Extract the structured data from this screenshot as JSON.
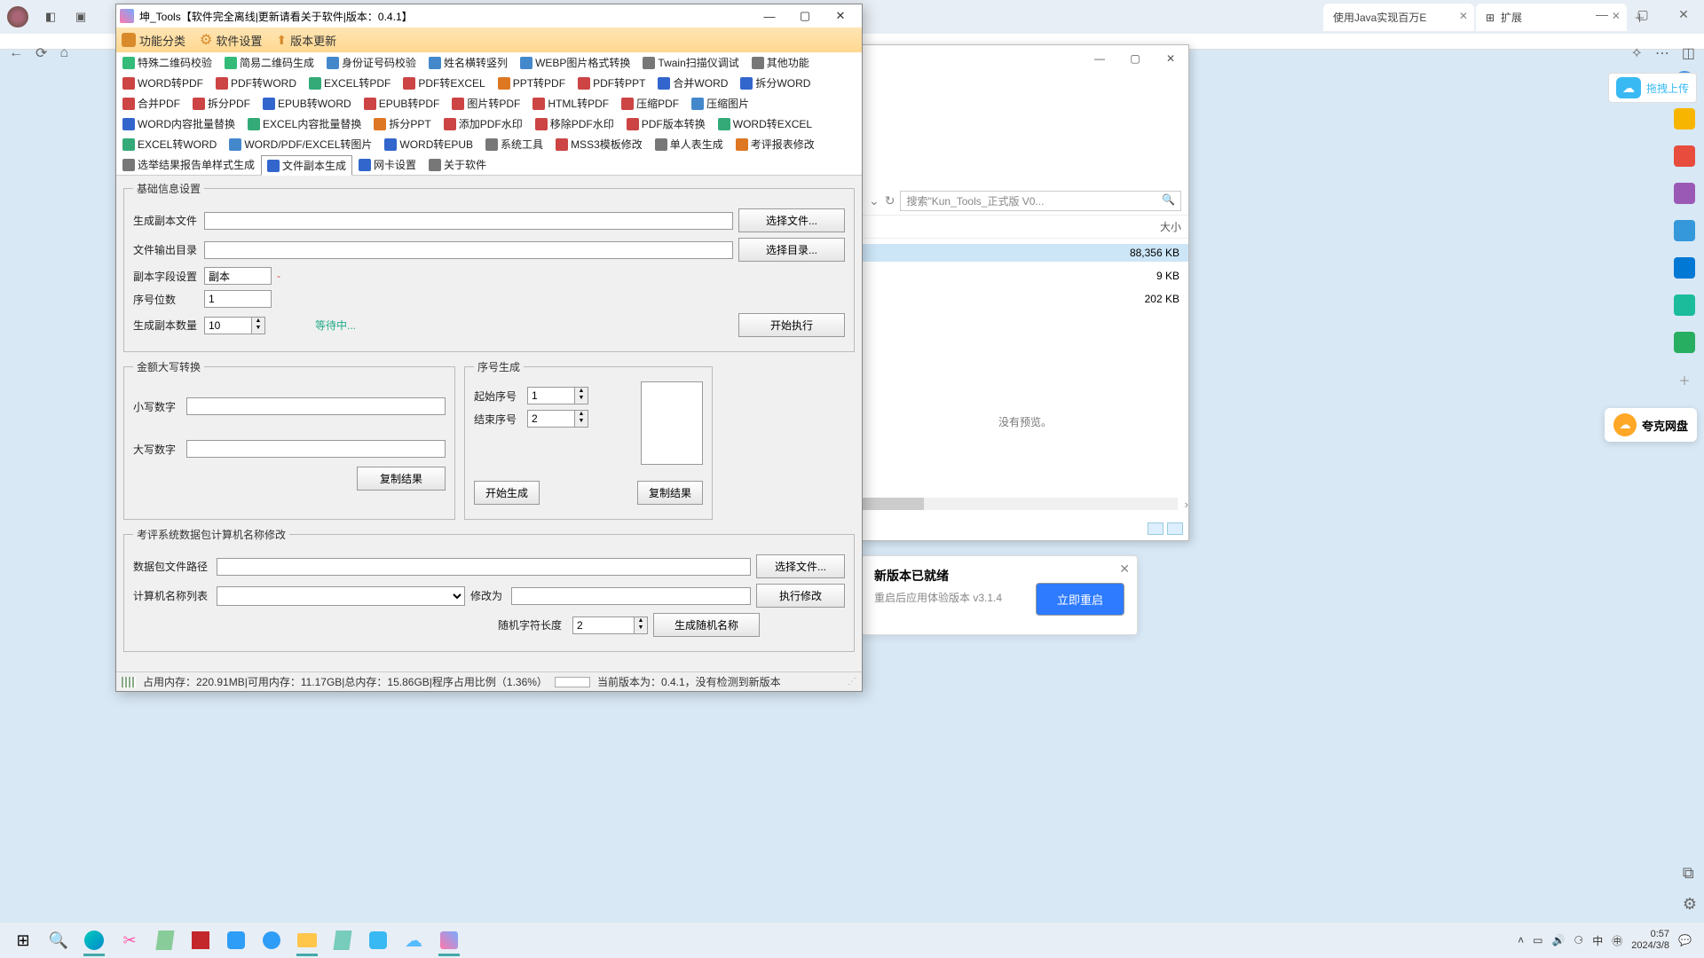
{
  "browser": {
    "tabs": [
      {
        "label": "使用Java实现百万E",
        "icon": "#4088d8"
      },
      {
        "label": "扩展",
        "icon": "#4088d8"
      }
    ],
    "win": [
      "—",
      "▢",
      "✕"
    ],
    "upload_label": "拖拽上传",
    "quark_label": "夸克网盘"
  },
  "explorer": {
    "win": [
      "—",
      "▢",
      "✕"
    ],
    "search_placeholder": "搜索\"Kun_Tools_正式版 V0...",
    "col_size": "大小",
    "rows": [
      {
        "size": "88,356 KB",
        "sel": true
      },
      {
        "size": "9 KB"
      },
      {
        "size": "202 KB"
      }
    ],
    "preview": "没有预览。"
  },
  "update": {
    "title": "新版本已就绪",
    "sub": "重启后应用体验版本 v3.1.4",
    "btn": "立即重启"
  },
  "app": {
    "title": "坤_Tools【软件完全离线|更新请看关于软件|版本：0.4.1】",
    "menu": [
      {
        "label": "功能分类",
        "color": "#d98b2b"
      },
      {
        "label": "软件设置",
        "color": "#d98b2b"
      },
      {
        "label": "版本更新",
        "color": "#d98b2b"
      }
    ],
    "tabs": [
      {
        "label": "特殊二维码校验",
        "c": "#3b7"
      },
      {
        "label": "简易二维码生成",
        "c": "#3b7"
      },
      {
        "label": "身份证号码校验",
        "c": "#48c"
      },
      {
        "label": "姓名横转竖列",
        "c": "#48c"
      },
      {
        "label": "WEBP图片格式转换",
        "c": "#48c"
      },
      {
        "label": "Twain扫描仪调试",
        "c": "#777"
      },
      {
        "label": "其他功能",
        "c": "#777"
      },
      {
        "label": "WORD转PDF",
        "c": "#c44"
      },
      {
        "label": "PDF转WORD",
        "c": "#c44"
      },
      {
        "label": "EXCEL转PDF",
        "c": "#3a7"
      },
      {
        "label": "PDF转EXCEL",
        "c": "#c44"
      },
      {
        "label": "PPT转PDF",
        "c": "#d72"
      },
      {
        "label": "PDF转PPT",
        "c": "#c44"
      },
      {
        "label": "合并WORD",
        "c": "#36c"
      },
      {
        "label": "拆分WORD",
        "c": "#36c"
      },
      {
        "label": "合并PDF",
        "c": "#c44"
      },
      {
        "label": "拆分PDF",
        "c": "#c44"
      },
      {
        "label": "EPUB转WORD",
        "c": "#36c"
      },
      {
        "label": "EPUB转PDF",
        "c": "#c44"
      },
      {
        "label": "图片转PDF",
        "c": "#c44"
      },
      {
        "label": "HTML转PDF",
        "c": "#c44"
      },
      {
        "label": "压缩PDF",
        "c": "#c44"
      },
      {
        "label": "压缩图片",
        "c": "#48c"
      },
      {
        "label": "WORD内容批量替换",
        "c": "#36c"
      },
      {
        "label": "EXCEL内容批量替换",
        "c": "#3a7"
      },
      {
        "label": "拆分PPT",
        "c": "#d72"
      },
      {
        "label": "添加PDF水印",
        "c": "#c44"
      },
      {
        "label": "移除PDF水印",
        "c": "#c44"
      },
      {
        "label": "PDF版本转换",
        "c": "#c44"
      },
      {
        "label": "WORD转EXCEL",
        "c": "#3a7"
      },
      {
        "label": "EXCEL转WORD",
        "c": "#3a7"
      },
      {
        "label": "WORD/PDF/EXCEL转图片",
        "c": "#48c"
      },
      {
        "label": "WORD转EPUB",
        "c": "#36c"
      },
      {
        "label": "系统工具",
        "c": "#777"
      },
      {
        "label": "MSS3模板修改",
        "c": "#c44"
      },
      {
        "label": "单人表生成",
        "c": "#777"
      },
      {
        "label": "考评报表修改",
        "c": "#d72"
      },
      {
        "label": "选举结果报告单样式生成",
        "c": "#777"
      },
      {
        "label": "文件副本生成",
        "c": "#36c",
        "active": true
      },
      {
        "label": "网卡设置",
        "c": "#36c"
      },
      {
        "label": "关于软件",
        "c": "#777"
      }
    ],
    "basic": {
      "legend": "基础信息设置",
      "gen_file_label": "生成副本文件",
      "choose_file": "选择文件...",
      "out_dir_label": "文件输出目录",
      "choose_dir": "选择目录...",
      "field_label": "副本字段设置",
      "field_value": "副本",
      "field_suffix": "-",
      "seq_digits_label": "序号位数",
      "seq_digits_value": "1",
      "copy_count_label": "生成副本数量",
      "copy_count_value": "10",
      "waiting": "等待中...",
      "start": "开始执行"
    },
    "caps": {
      "legend": "金额大写转换",
      "lower_label": "小写数字",
      "upper_label": "大写数字",
      "copy": "复制结果"
    },
    "seq": {
      "legend": "序号生成",
      "start_label": "起始序号",
      "start_value": "1",
      "end_label": "结束序号",
      "end_value": "2",
      "gen": "开始生成",
      "copy": "复制结果"
    },
    "exam": {
      "legend": "考评系统数据包计算机名称修改",
      "pkg_label": "数据包文件路径",
      "choose": "选择文件...",
      "list_label": "计算机名称列表",
      "change_label": "修改为",
      "exec": "执行修改",
      "rand_len_label": "随机字符长度",
      "rand_len_value": "2",
      "gen_rand": "生成随机名称"
    },
    "status": {
      "mem": "占用内存：220.91MB|可用内存：11.17GB|总内存：15.86GB|程序占用比例（1.36%）",
      "ver": "当前版本为：0.4.1，没有检测到新版本"
    }
  },
  "taskbar": {
    "time": "0:57",
    "date": "2024/3/8",
    "ime": "中"
  },
  "rail_colors": [
    "#f7b500",
    "#4a90e2",
    "#e74c3c",
    "#9b59b6",
    "#3498db",
    "#0078d4",
    "#1abc9c",
    "#27ae60"
  ]
}
